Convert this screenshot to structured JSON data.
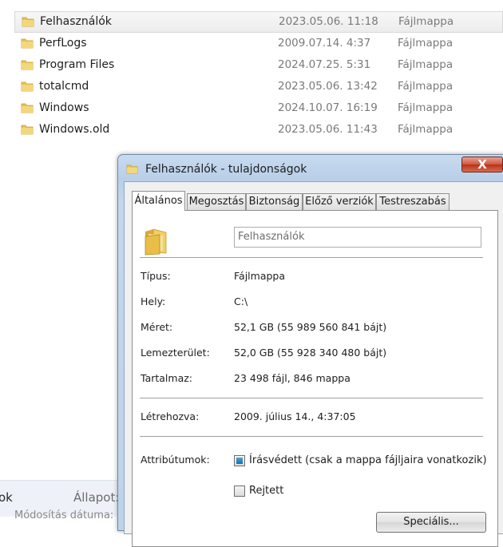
{
  "file_list": [
    {
      "name": "Felhasználók",
      "date": "2023.05.06. 11:18",
      "type": "Fájlmappa",
      "selected": true
    },
    {
      "name": "PerfLogs",
      "date": "2009.07.14. 4:37",
      "type": "Fájlmappa"
    },
    {
      "name": "Program Files",
      "date": "2024.07.25. 5:31",
      "type": "Fájlmappa"
    },
    {
      "name": "totalcmd",
      "date": "2023.05.06. 13:42",
      "type": "Fájlmappa"
    },
    {
      "name": "Windows",
      "date": "2024.10.07. 16:19",
      "type": "Fájlmappa"
    },
    {
      "name": "Windows.old",
      "date": "2023.05.06. 11:43",
      "type": "Fájlmappa"
    }
  ],
  "status_bar": {
    "left_text": "ok",
    "state_label": "Állapot:",
    "modified_label": "Módosítás dátuma:"
  },
  "dialog": {
    "title": "Felhasználók - tulajdonságok",
    "close_label": "X",
    "tabs": [
      {
        "label": "Általános",
        "active": true
      },
      {
        "label": "Megosztás"
      },
      {
        "label": "Biztonság"
      },
      {
        "label": "Előző verziók"
      },
      {
        "label": "Testreszabás"
      }
    ],
    "folder_name": "Felhasználók",
    "properties": {
      "type_label": "Típus:",
      "type_value": "Fájlmappa",
      "location_label": "Hely:",
      "location_value": "C:\\",
      "size_label": "Méret:",
      "size_value": "52,1 GB (55 989 560 841 bájt)",
      "disk_label": "Lemezterület:",
      "disk_value": "52,0 GB (55 928 340 480 bájt)",
      "contains_label": "Tartalmaz:",
      "contains_value": "23 498 fájl, 846 mappa",
      "created_label": "Létrehozva:",
      "created_value": "2009. július 14., 4:37:05",
      "attributes_label": "Attribútumok:"
    },
    "attributes": {
      "readonly_label": "Írásvédett (csak a mappa fájljaira vonatkozik)",
      "readonly_state": "indeterminate",
      "hidden_label": "Rejtett",
      "hidden_state": "unchecked"
    },
    "advanced_button": "Speciális...",
    "colors": {
      "title_bar": "#bed3ea",
      "close_button": "#c7412a",
      "folder_icon": "#e8c35a"
    },
    "icons": [
      "folder-icon",
      "close-icon"
    ]
  }
}
